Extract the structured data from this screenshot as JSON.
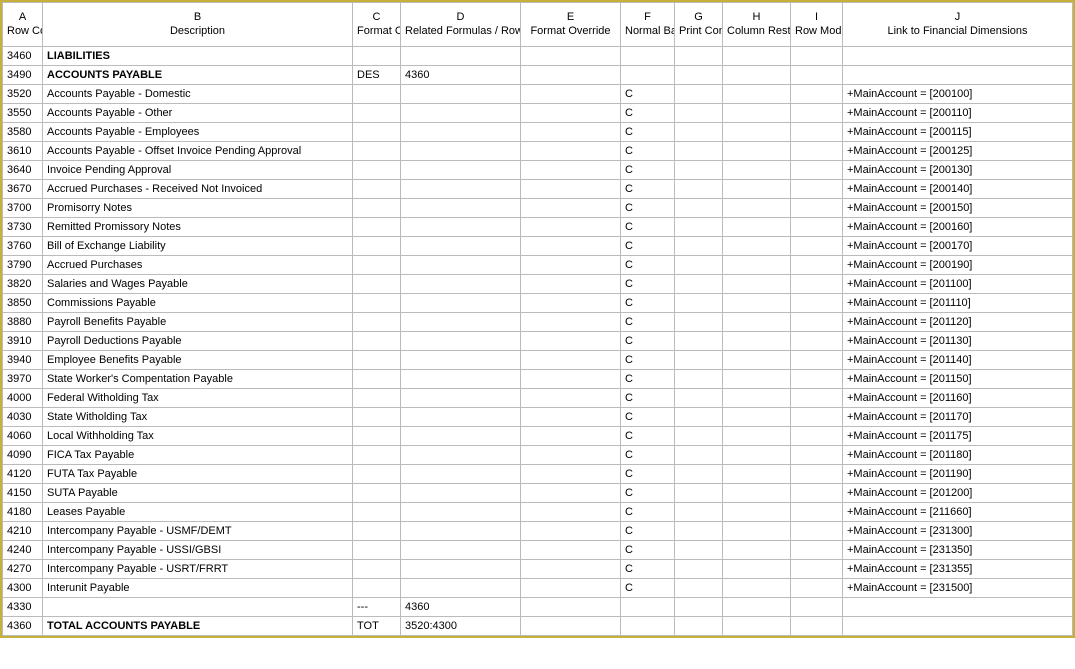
{
  "headers": {
    "a": "A\nRow Code",
    "b": "B\nDescription",
    "c": "C\nFormat Code",
    "d": "D\nRelated Formulas / Rows / Units",
    "e": "E\nFormat Override",
    "f": "F\nNormal Balance",
    "g": "G\nPrint Control",
    "h": "H\nColumn Restriction",
    "i": "I\nRow Modifier",
    "j": "J\nLink to Financial Dimensions"
  },
  "rows": [
    {
      "code": "3460",
      "desc": "LIABILITIES",
      "fmt": "",
      "rel": "",
      "ovr": "",
      "bal": "",
      "prt": "",
      "col": "",
      "mod": "",
      "link": "",
      "bold": true
    },
    {
      "code": "3490",
      "desc": "ACCOUNTS PAYABLE",
      "fmt": "DES",
      "rel": "4360",
      "ovr": "",
      "bal": "",
      "prt": "",
      "col": "",
      "mod": "",
      "link": "",
      "bold": true
    },
    {
      "code": "3520",
      "desc": "Accounts Payable - Domestic",
      "fmt": "",
      "rel": "",
      "ovr": "",
      "bal": "C",
      "prt": "",
      "col": "",
      "mod": "",
      "link": "+MainAccount = [200100]",
      "bold": false
    },
    {
      "code": "3550",
      "desc": "Accounts Payable - Other",
      "fmt": "",
      "rel": "",
      "ovr": "",
      "bal": "C",
      "prt": "",
      "col": "",
      "mod": "",
      "link": "+MainAccount = [200110]",
      "bold": false
    },
    {
      "code": "3580",
      "desc": "Accounts Payable - Employees",
      "fmt": "",
      "rel": "",
      "ovr": "",
      "bal": "C",
      "prt": "",
      "col": "",
      "mod": "",
      "link": "+MainAccount = [200115]",
      "bold": false
    },
    {
      "code": "3610",
      "desc": "Accounts Payable - Offset Invoice Pending Approval",
      "fmt": "",
      "rel": "",
      "ovr": "",
      "bal": "C",
      "prt": "",
      "col": "",
      "mod": "",
      "link": "+MainAccount = [200125]",
      "bold": false
    },
    {
      "code": "3640",
      "desc": "Invoice Pending Approval",
      "fmt": "",
      "rel": "",
      "ovr": "",
      "bal": "C",
      "prt": "",
      "col": "",
      "mod": "",
      "link": "+MainAccount = [200130]",
      "bold": false
    },
    {
      "code": "3670",
      "desc": "Accrued Purchases - Received Not Invoiced",
      "fmt": "",
      "rel": "",
      "ovr": "",
      "bal": "C",
      "prt": "",
      "col": "",
      "mod": "",
      "link": "+MainAccount = [200140]",
      "bold": false
    },
    {
      "code": "3700",
      "desc": "Promisorry Notes",
      "fmt": "",
      "rel": "",
      "ovr": "",
      "bal": "C",
      "prt": "",
      "col": "",
      "mod": "",
      "link": "+MainAccount = [200150]",
      "bold": false
    },
    {
      "code": "3730",
      "desc": "Remitted Promissory Notes",
      "fmt": "",
      "rel": "",
      "ovr": "",
      "bal": "C",
      "prt": "",
      "col": "",
      "mod": "",
      "link": "+MainAccount = [200160]",
      "bold": false
    },
    {
      "code": "3760",
      "desc": "Bill of Exchange Liability",
      "fmt": "",
      "rel": "",
      "ovr": "",
      "bal": "C",
      "prt": "",
      "col": "",
      "mod": "",
      "link": "+MainAccount = [200170]",
      "bold": false
    },
    {
      "code": "3790",
      "desc": "Accrued Purchases",
      "fmt": "",
      "rel": "",
      "ovr": "",
      "bal": "C",
      "prt": "",
      "col": "",
      "mod": "",
      "link": "+MainAccount = [200190]",
      "bold": false
    },
    {
      "code": "3820",
      "desc": "Salaries and Wages Payable",
      "fmt": "",
      "rel": "",
      "ovr": "",
      "bal": "C",
      "prt": "",
      "col": "",
      "mod": "",
      "link": "+MainAccount = [201100]",
      "bold": false
    },
    {
      "code": "3850",
      "desc": "Commissions Payable",
      "fmt": "",
      "rel": "",
      "ovr": "",
      "bal": "C",
      "prt": "",
      "col": "",
      "mod": "",
      "link": "+MainAccount = [201110]",
      "bold": false
    },
    {
      "code": "3880",
      "desc": "Payroll Benefits Payable",
      "fmt": "",
      "rel": "",
      "ovr": "",
      "bal": "C",
      "prt": "",
      "col": "",
      "mod": "",
      "link": "+MainAccount = [201120]",
      "bold": false
    },
    {
      "code": "3910",
      "desc": "Payroll Deductions Payable",
      "fmt": "",
      "rel": "",
      "ovr": "",
      "bal": "C",
      "prt": "",
      "col": "",
      "mod": "",
      "link": "+MainAccount = [201130]",
      "bold": false
    },
    {
      "code": "3940",
      "desc": "Employee Benefits Payable",
      "fmt": "",
      "rel": "",
      "ovr": "",
      "bal": "C",
      "prt": "",
      "col": "",
      "mod": "",
      "link": "+MainAccount = [201140]",
      "bold": false
    },
    {
      "code": "3970",
      "desc": "State Worker's Compentation Payable",
      "fmt": "",
      "rel": "",
      "ovr": "",
      "bal": "C",
      "prt": "",
      "col": "",
      "mod": "",
      "link": "+MainAccount = [201150]",
      "bold": false
    },
    {
      "code": "4000",
      "desc": "Federal Witholding Tax",
      "fmt": "",
      "rel": "",
      "ovr": "",
      "bal": "C",
      "prt": "",
      "col": "",
      "mod": "",
      "link": "+MainAccount = [201160]",
      "bold": false
    },
    {
      "code": "4030",
      "desc": "State Witholding Tax",
      "fmt": "",
      "rel": "",
      "ovr": "",
      "bal": "C",
      "prt": "",
      "col": "",
      "mod": "",
      "link": "+MainAccount = [201170]",
      "bold": false
    },
    {
      "code": "4060",
      "desc": "Local Withholding Tax",
      "fmt": "",
      "rel": "",
      "ovr": "",
      "bal": "C",
      "prt": "",
      "col": "",
      "mod": "",
      "link": "+MainAccount = [201175]",
      "bold": false
    },
    {
      "code": "4090",
      "desc": "FICA Tax Payable",
      "fmt": "",
      "rel": "",
      "ovr": "",
      "bal": "C",
      "prt": "",
      "col": "",
      "mod": "",
      "link": "+MainAccount = [201180]",
      "bold": false
    },
    {
      "code": "4120",
      "desc": "FUTA Tax Payable",
      "fmt": "",
      "rel": "",
      "ovr": "",
      "bal": "C",
      "prt": "",
      "col": "",
      "mod": "",
      "link": "+MainAccount = [201190]",
      "bold": false
    },
    {
      "code": "4150",
      "desc": "SUTA Payable",
      "fmt": "",
      "rel": "",
      "ovr": "",
      "bal": "C",
      "prt": "",
      "col": "",
      "mod": "",
      "link": "+MainAccount = [201200]",
      "bold": false
    },
    {
      "code": "4180",
      "desc": "Leases Payable",
      "fmt": "",
      "rel": "",
      "ovr": "",
      "bal": "C",
      "prt": "",
      "col": "",
      "mod": "",
      "link": "+MainAccount = [211660]",
      "bold": false
    },
    {
      "code": "4210",
      "desc": "Intercompany Payable - USMF/DEMT",
      "fmt": "",
      "rel": "",
      "ovr": "",
      "bal": "C",
      "prt": "",
      "col": "",
      "mod": "",
      "link": "+MainAccount = [231300]",
      "bold": false
    },
    {
      "code": "4240",
      "desc": "Intercompany Payable - USSI/GBSI",
      "fmt": "",
      "rel": "",
      "ovr": "",
      "bal": "C",
      "prt": "",
      "col": "",
      "mod": "",
      "link": "+MainAccount = [231350]",
      "bold": false
    },
    {
      "code": "4270",
      "desc": "Intercompany Payable - USRT/FRRT",
      "fmt": "",
      "rel": "",
      "ovr": "",
      "bal": "C",
      "prt": "",
      "col": "",
      "mod": "",
      "link": "+MainAccount = [231355]",
      "bold": false
    },
    {
      "code": "4300",
      "desc": "Interunit Payable",
      "fmt": "",
      "rel": "",
      "ovr": "",
      "bal": "C",
      "prt": "",
      "col": "",
      "mod": "",
      "link": "+MainAccount = [231500]",
      "bold": false
    },
    {
      "code": "4330",
      "desc": "",
      "fmt": "---",
      "rel": "4360",
      "ovr": "",
      "bal": "",
      "prt": "",
      "col": "",
      "mod": "",
      "link": "",
      "bold": false
    },
    {
      "code": "4360",
      "desc": "TOTAL ACCOUNTS PAYABLE",
      "fmt": "TOT",
      "rel": "3520:4300",
      "ovr": "",
      "bal": "",
      "prt": "",
      "col": "",
      "mod": "",
      "link": "",
      "bold": true
    }
  ]
}
